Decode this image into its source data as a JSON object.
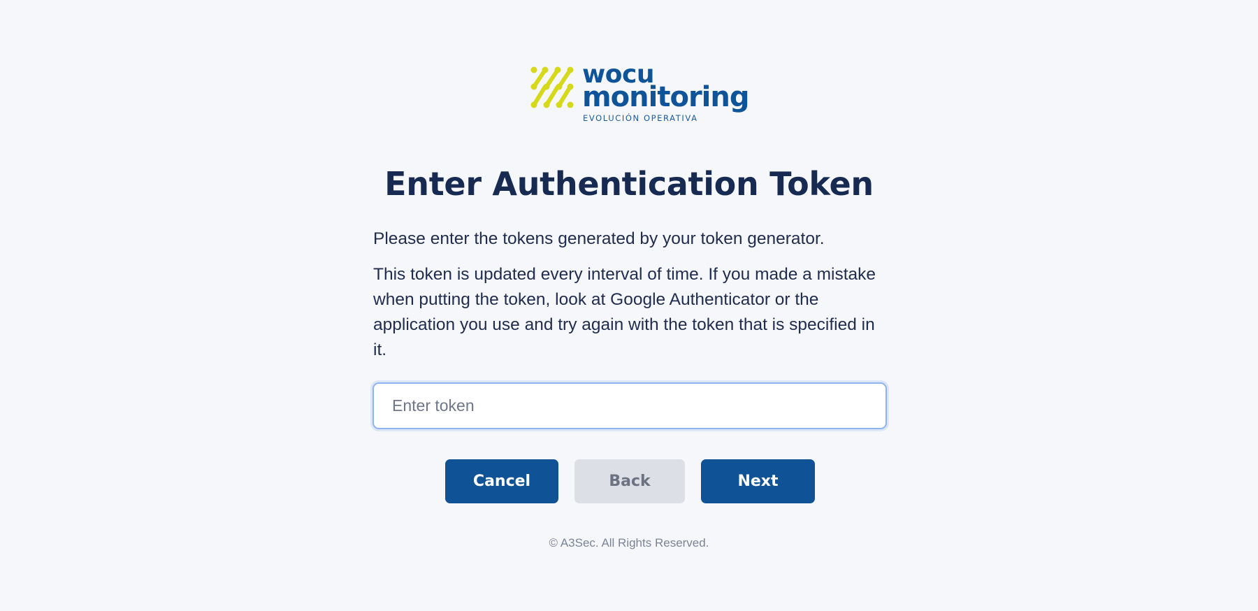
{
  "brand": {
    "logo_line_1": "wocu",
    "logo_line_2": "monitoring",
    "tagline": "EVOLUCIÓN OPERATIVA",
    "mark_icon": "network-nodes-icon",
    "mark_color": "#d6d91a",
    "text_color": "#0f5398"
  },
  "page": {
    "title": "Enter Authentication Token",
    "intro": "Please enter the tokens generated by your token generator.",
    "instructions": "This token is updated every interval of time. If you made a mistake when putting the token, look at Google Authenticator or the application you use and try again with the token that is specified in it."
  },
  "token_input": {
    "value": "",
    "placeholder": "Enter token"
  },
  "buttons": {
    "cancel_label": "Cancel",
    "back_label": "Back",
    "next_label": "Next",
    "primary_color": "#0f5396",
    "disabled_color": "#dcdfe6"
  },
  "footer": {
    "copyright": "© A3Sec. All Rights Reserved."
  }
}
